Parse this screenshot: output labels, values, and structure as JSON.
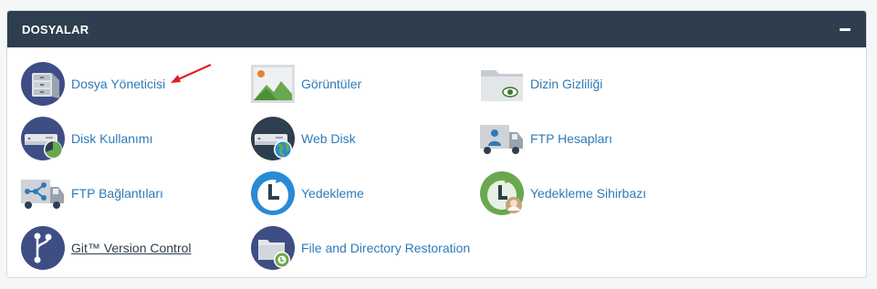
{
  "panel": {
    "title": "DOSYALAR"
  },
  "items": [
    {
      "label": "Dosya Yöneticisi",
      "icon": "file-manager-icon"
    },
    {
      "label": "Görüntüler",
      "icon": "images-icon"
    },
    {
      "label": "Dizin Gizliliği",
      "icon": "directory-privacy-icon"
    },
    {
      "label": "Disk Kullanımı",
      "icon": "disk-usage-icon"
    },
    {
      "label": "Web Disk",
      "icon": "web-disk-icon"
    },
    {
      "label": "FTP Hesapları",
      "icon": "ftp-accounts-icon"
    },
    {
      "label": "FTP Bağlantıları",
      "icon": "ftp-connections-icon"
    },
    {
      "label": "Yedekleme",
      "icon": "backup-icon"
    },
    {
      "label": "Yedekleme Sihirbazı",
      "icon": "backup-wizard-icon"
    },
    {
      "label": "Git™ Version Control",
      "icon": "git-icon"
    },
    {
      "label": "File and Directory Restoration",
      "icon": "file-restoration-icon"
    }
  ],
  "colors": {
    "header_bg": "#2e3e4e",
    "link": "#2f7ab6",
    "icon_navy": "#3f4d85",
    "icon_green": "#6aa84f",
    "icon_blue": "#2a8ad4",
    "annotation_arrow": "#e02020"
  }
}
